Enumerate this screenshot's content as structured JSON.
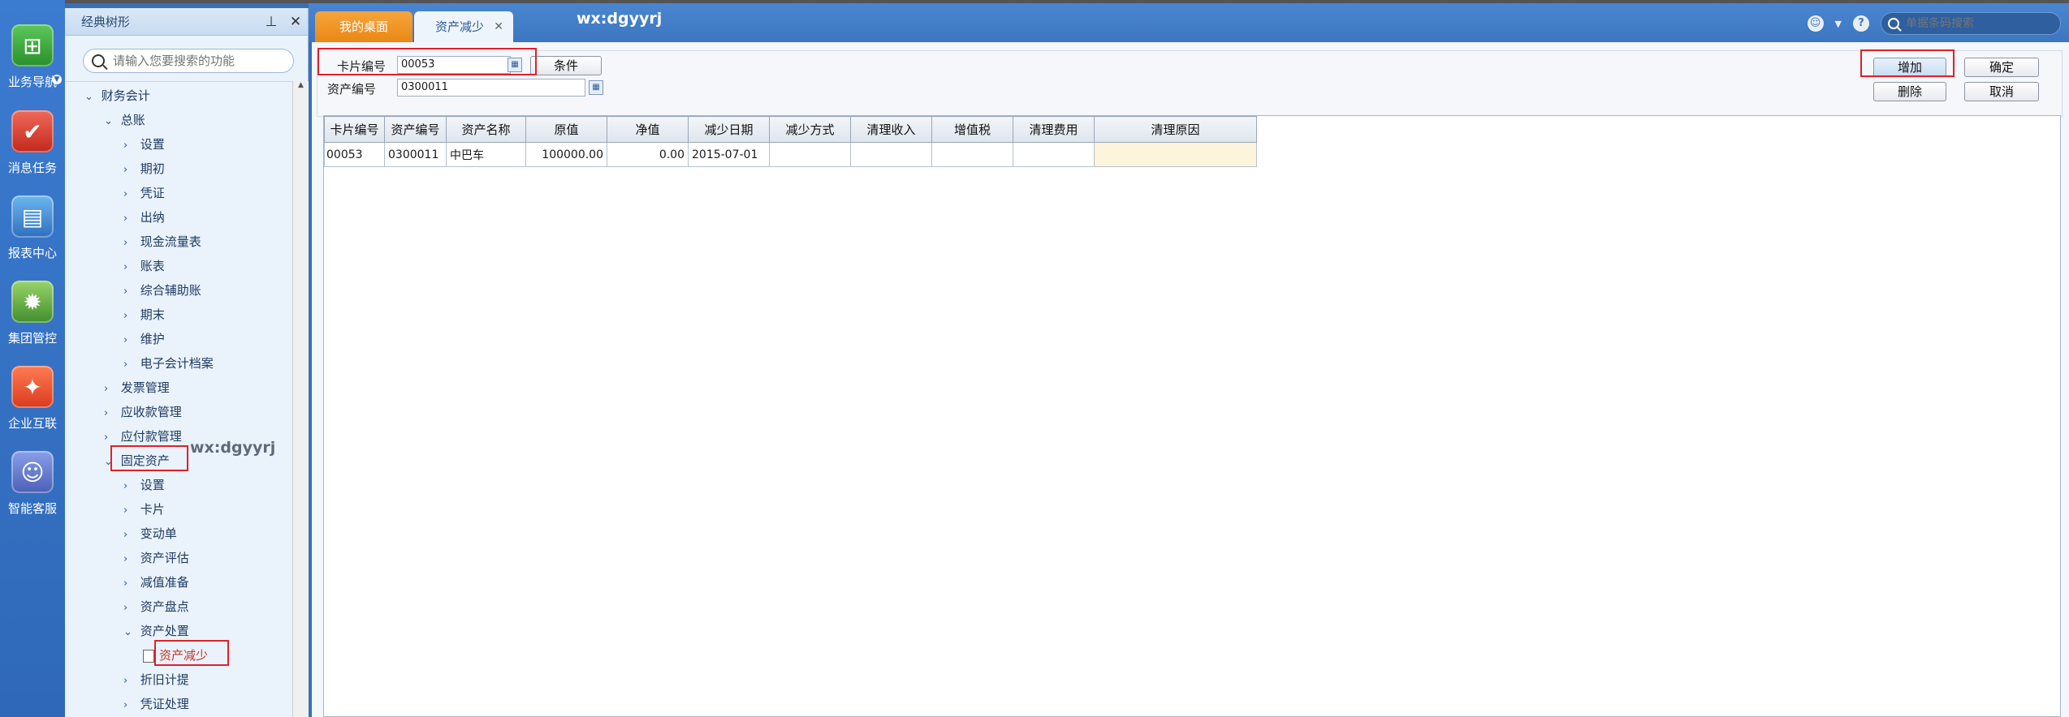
{
  "rail": {
    "items": [
      {
        "label": "业务导航",
        "icon": "business-nav-icon"
      },
      {
        "label": "消息任务",
        "icon": "message-task-icon"
      },
      {
        "label": "报表中心",
        "icon": "report-center-icon"
      },
      {
        "label": "集团管控",
        "icon": "group-control-icon"
      },
      {
        "label": "企业互联",
        "icon": "enterprise-connect-icon"
      },
      {
        "label": "智能客服",
        "icon": "smart-service-icon"
      }
    ]
  },
  "tree": {
    "title": "经典树形",
    "search_placeholder": "请输入您要搜索的功能",
    "nodes": {
      "finance": "财务会计",
      "gl": "总账",
      "gl_items": [
        "设置",
        "期初",
        "凭证",
        "出纳",
        "现金流量表",
        "账表",
        "综合辅助账",
        "期末",
        "维护",
        "电子会计档案"
      ],
      "invoice": "发票管理",
      "ar": "应收款管理",
      "ap": "应付款管理",
      "fa": "固定资产",
      "fa_items": [
        "设置",
        "卡片",
        "变动单",
        "资产评估",
        "减值准备",
        "资产盘点"
      ],
      "disposal": "资产处置",
      "asset_reduction": "资产减少",
      "fa_after": [
        "折旧计提",
        "凭证处理"
      ]
    }
  },
  "topbar": {
    "tab_home": "我的桌面",
    "tab_active": "资产减少",
    "watermark": "wx:dgyyrj",
    "search_placeholder": "单据条码搜索"
  },
  "form": {
    "card_label": "卡片编号",
    "card_value": "00053",
    "asset_label": "资产编号",
    "asset_value": "0300011",
    "condition_button": "条件",
    "add_button": "增加",
    "confirm_button": "确定",
    "delete_button": "删除",
    "cancel_button": "取消"
  },
  "tree_watermark": "wx:dgyyrj",
  "grid": {
    "headers": [
      "卡片编号",
      "资产编号",
      "资产名称",
      "原值",
      "净值",
      "减少日期",
      "减少方式",
      "清理收入",
      "增值税",
      "清理费用",
      "清理原因"
    ],
    "rows": [
      [
        "00053",
        "0300011",
        "中巴车",
        "100000.00",
        "0.00",
        "2015-07-01",
        "",
        "",
        "",
        "",
        ""
      ]
    ]
  }
}
